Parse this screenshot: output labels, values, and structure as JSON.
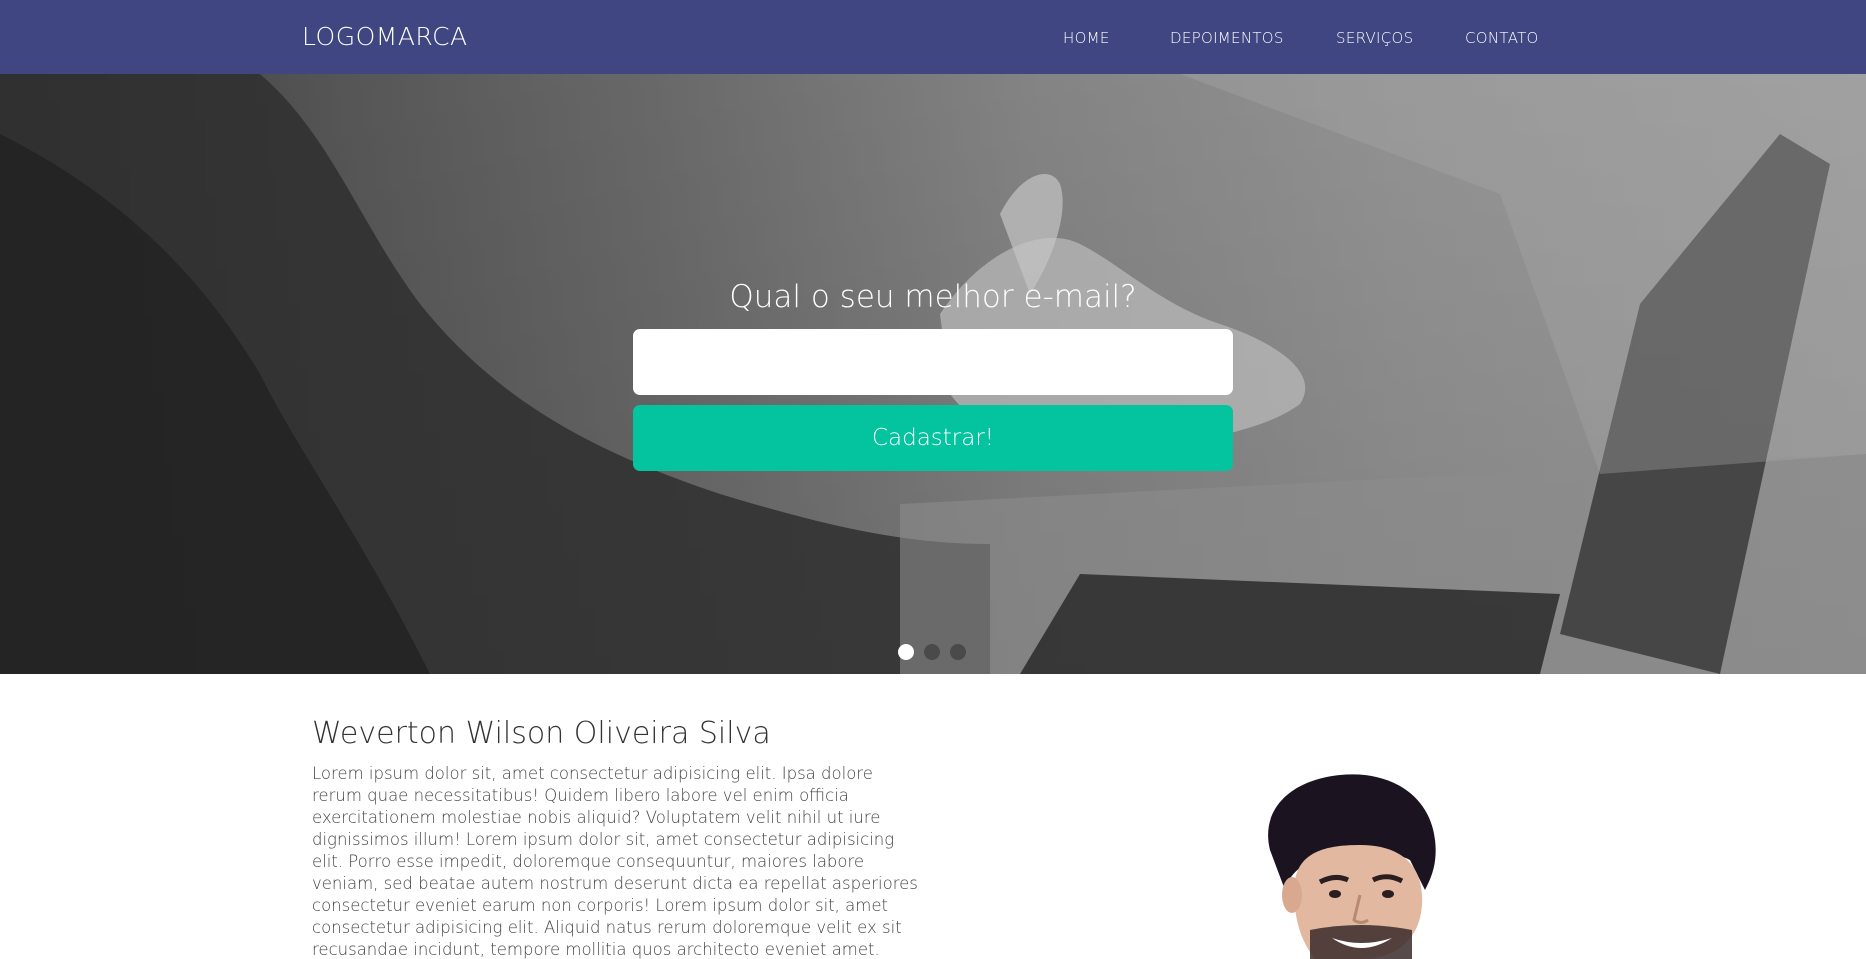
{
  "navbar": {
    "logo": "LOGOMARCA",
    "links": [
      {
        "label": "HOME"
      },
      {
        "label": "DEPOIMENTOS"
      },
      {
        "label": "SERVIÇOS"
      },
      {
        "label": "CONTATO"
      }
    ],
    "background": "#3f4681"
  },
  "hero": {
    "heading": "Qual o seu melhor e-mail?",
    "email_value": "",
    "email_placeholder": "",
    "submit_label": "Cadastrar!",
    "submit_color": "#04c4a0",
    "carousel": {
      "slides": 3,
      "active_index": 0
    }
  },
  "about": {
    "name": "Weverton Wilson Oliveira Silva",
    "text": "Lorem ipsum dolor sit, amet consectetur adipisicing elit. Ipsa dolore rerum quae necessitatibus! Quidem libero labore vel enim officia exercitationem molestiae nobis aliquid? Voluptatem velit nihil ut iure dignissimos illum! Lorem ipsum dolor sit, amet consectetur adipisicing elit. Porro esse impedit, doloremque consequuntur, maiores labore veniam, sed beatae autem nostrum deserunt dicta ea repellat asperiores consectetur eveniet earum non corporis! Lorem ipsum dolor sit, amet consectetur adipisicing elit. Aliquid natus rerum doloremque velit ex sit recusandae incidunt, tempore mollitia quos architecto eveniet amet. Voluptatibus ipsa odio, eligendi delectus hic nulla!"
  }
}
